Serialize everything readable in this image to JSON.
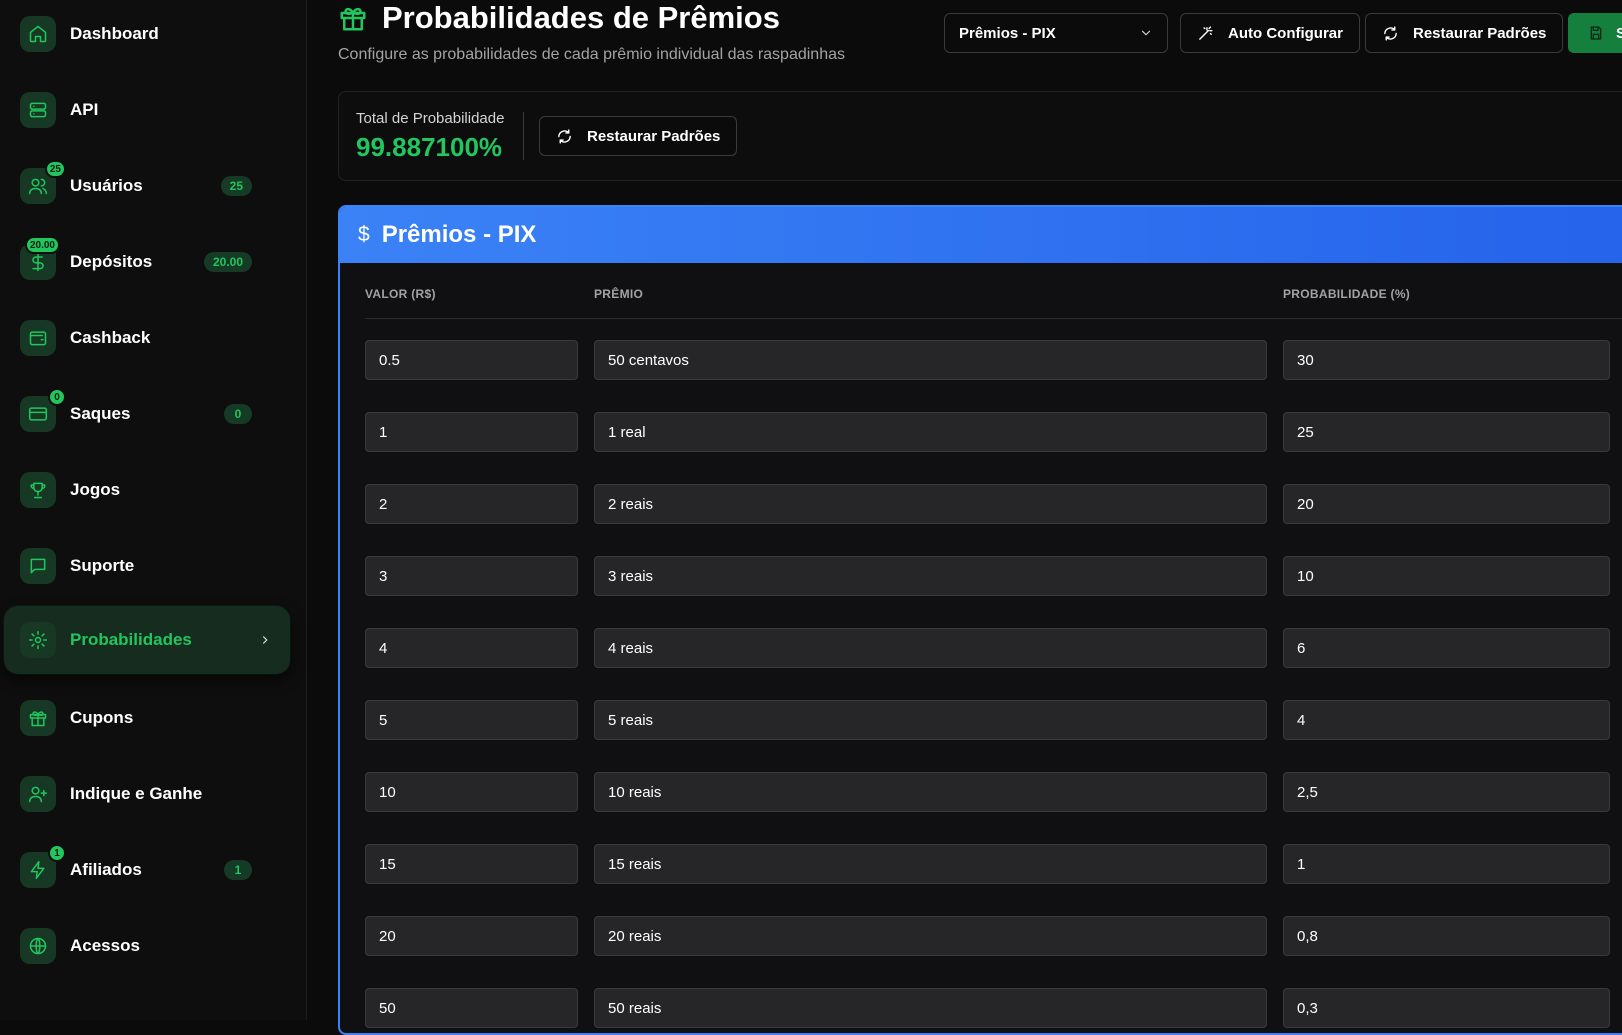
{
  "sidebar": {
    "items": [
      {
        "label": "Dashboard",
        "icon": "home-icon"
      },
      {
        "label": "API",
        "icon": "server-icon"
      },
      {
        "label": "Usuários",
        "icon": "users-icon",
        "badge": "25",
        "count": "25"
      },
      {
        "label": "Depósitos",
        "icon": "dollar-icon",
        "badge": "20.00",
        "count": "20.00"
      },
      {
        "label": "Cashback",
        "icon": "wallet-icon"
      },
      {
        "label": "Saques",
        "icon": "credit-card-icon",
        "badge": "0",
        "count": "0"
      },
      {
        "label": "Jogos",
        "icon": "trophy-icon"
      },
      {
        "label": "Suporte",
        "icon": "message-icon"
      },
      {
        "label": "Probabilidades",
        "icon": "gear-icon",
        "active": true
      },
      {
        "label": "Cupons",
        "icon": "gift-icon"
      },
      {
        "label": "Indique e Ganhe",
        "icon": "user-plus-icon"
      },
      {
        "label": "Afiliados",
        "icon": "zap-icon",
        "badge": "1",
        "count": "1"
      },
      {
        "label": "Acessos",
        "icon": "globe-icon"
      }
    ]
  },
  "header": {
    "title": "Probabilidades de Prêmios",
    "subtitle": "Configure as probabilidades de cada prêmio individual das raspadinhas",
    "select_value": "Prêmios - PIX",
    "auto_config_label": "Auto Configurar",
    "restore_label": "Restaurar Padrões",
    "save_label": "S"
  },
  "total": {
    "label": "Total de Probabilidade",
    "value": "99.887100%",
    "restore_label": "Restaurar Padrões"
  },
  "panel": {
    "title": "Prêmios - PIX",
    "columns": [
      "VALOR (R$)",
      "PRÊMIO",
      "PROBABILIDADE (%)"
    ],
    "rows": [
      {
        "valor": "0.5",
        "premio": "50 centavos",
        "prob": "30"
      },
      {
        "valor": "1",
        "premio": "1 real",
        "prob": "25"
      },
      {
        "valor": "2",
        "premio": "2 reais",
        "prob": "20"
      },
      {
        "valor": "3",
        "premio": "3 reais",
        "prob": "10"
      },
      {
        "valor": "4",
        "premio": "4 reais",
        "prob": "6"
      },
      {
        "valor": "5",
        "premio": "5 reais",
        "prob": "4"
      },
      {
        "valor": "10",
        "premio": "10 reais",
        "prob": "2,5"
      },
      {
        "valor": "15",
        "premio": "15 reais",
        "prob": "1"
      },
      {
        "valor": "20",
        "premio": "20 reais",
        "prob": "0,8"
      },
      {
        "valor": "50",
        "premio": "50 reais",
        "prob": "0,3"
      }
    ]
  },
  "colors": {
    "accent": "#22c55e",
    "panel_header": "#3b82f6",
    "background": "#0b0b0c"
  }
}
